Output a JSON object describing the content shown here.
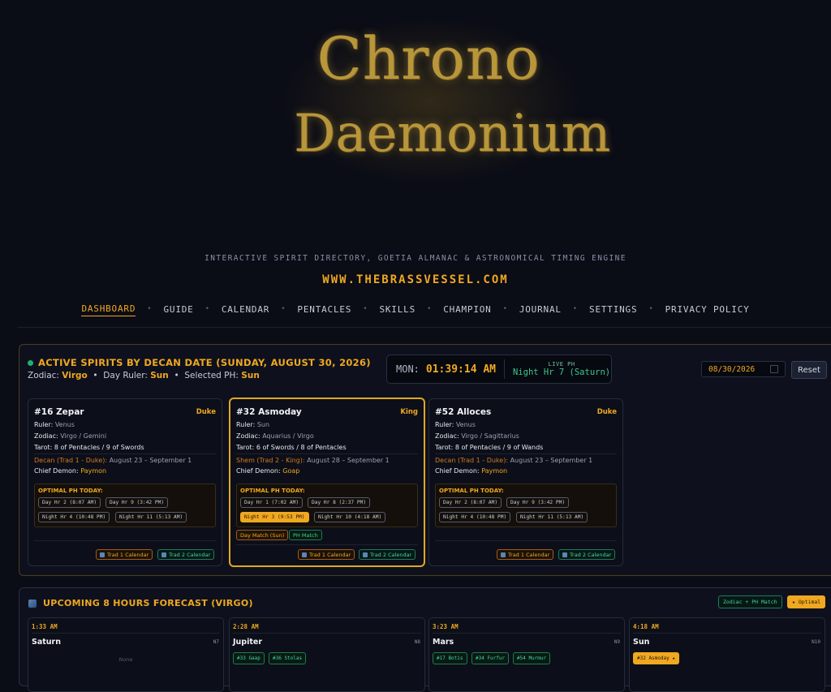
{
  "header": {
    "logo_line1": "Chrono",
    "logo_line2": "Daemonium",
    "tagline": "INTERACTIVE SPIRIT DIRECTORY, GOETIA ALMANAC & ASTRONOMICAL TIMING ENGINE",
    "site": "WWW.THEBRASSVESSEL.COM"
  },
  "nav": [
    "DASHBOARD",
    "GUIDE",
    "CALENDAR",
    "PENTACLES",
    "SKILLS",
    "CHAMPION",
    "JOURNAL",
    "SETTINGS",
    "PRIVACY POLICY"
  ],
  "active": {
    "title": "ACTIVE SPIRITS BY DECAN DATE (SUNDAY, AUGUST 30, 2026)",
    "zodiac_label": "Zodiac:",
    "zodiac": "Virgo",
    "ruler_label": "Day Ruler:",
    "ruler": "Sun",
    "ph_label": "Selected PH:",
    "ph": "Sun",
    "clock_label": "MON:",
    "clock_time": "01:39:14 AM",
    "live_ph_label": "LIVE PH",
    "live_ph": "Night Hr 7 (Saturn)",
    "date_value": "08/30/2026",
    "reset": "Reset",
    "cards": [
      {
        "name": "#16 Zepar",
        "rank": "Duke",
        "ruler": "Venus",
        "zodiac": "Virgo / Gemini",
        "tarot": "8 of Pentacles / 9 of Swords",
        "decan_label": "Decan (Trad 1 - Duke):",
        "decan": "August 23 – September 1",
        "chief": "Paymon",
        "chips": [
          "Day Hr 2 (8:07 AM)",
          "Day Hr 9 (3:42 PM)",
          "Night Hr 4 (10:48 PM)",
          "Night Hr 11 (5:13 AM)"
        ]
      },
      {
        "name": "#32 Asmoday",
        "rank": "King",
        "ruler": "Sun",
        "zodiac": "Aquarius / Virgo",
        "tarot": "6 of Swords / 8 of Pentacles",
        "decan_label": "Shem (Trad 2 - King):",
        "decan": "August 28 – September 1",
        "chief": "Goap",
        "chips": [
          "Day Hr 1 (7:02 AM)",
          "Day Hr 8 (2:37 PM)",
          "Night Hr 3 (9:53 PM)",
          "Night Hr 10 (4:18 AM)"
        ],
        "tags": [
          "Day Match (Sun)",
          "PH Match"
        ]
      },
      {
        "name": "#52 Alloces",
        "rank": "Duke",
        "ruler": "Venus",
        "zodiac": "Virgo / Sagittarius",
        "tarot": "8 of Pentacles / 9 of Wands",
        "decan_label": "Decan (Trad 1 - Duke):",
        "decan": "August 23 – September 1",
        "chief": "Paymon",
        "chips": [
          "Day Hr 2 (8:07 AM)",
          "Day Hr 9 (3:42 PM)",
          "Night Hr 4 (10:48 PM)",
          "Night Hr 11 (5:13 AM)"
        ]
      }
    ],
    "labels": {
      "ruler": "Ruler:",
      "zodiac": "Zodiac:",
      "tarot": "Tarot:",
      "chief": "Chief Demon:",
      "optimal": "OPTIMAL PH TODAY:",
      "trad1": "Trad 1 Calendar",
      "trad2": "Trad 2 Calendar"
    }
  },
  "forecast": {
    "title": "UPCOMING 8 HOURS FORECAST (VIRGO)",
    "legend1": "Zodiac + PH Match",
    "legend2": "★ Optimal",
    "cols": [
      {
        "time": "1:33 AM",
        "planet": "Saturn",
        "hr": "N7",
        "none": "None"
      },
      {
        "time": "2:28 AM",
        "planet": "Jupiter",
        "hr": "N8",
        "chips": [
          "#33 Gaap",
          "#36 Stolas"
        ]
      },
      {
        "time": "3:23 AM",
        "planet": "Mars",
        "hr": "N9",
        "chips": [
          "#17 Botis",
          "#34 Furfur",
          "#54 Murmur"
        ]
      },
      {
        "time": "4:18 AM",
        "planet": "Sun",
        "hr": "N10",
        "gold": "#32 Asmoday ★"
      }
    ]
  }
}
